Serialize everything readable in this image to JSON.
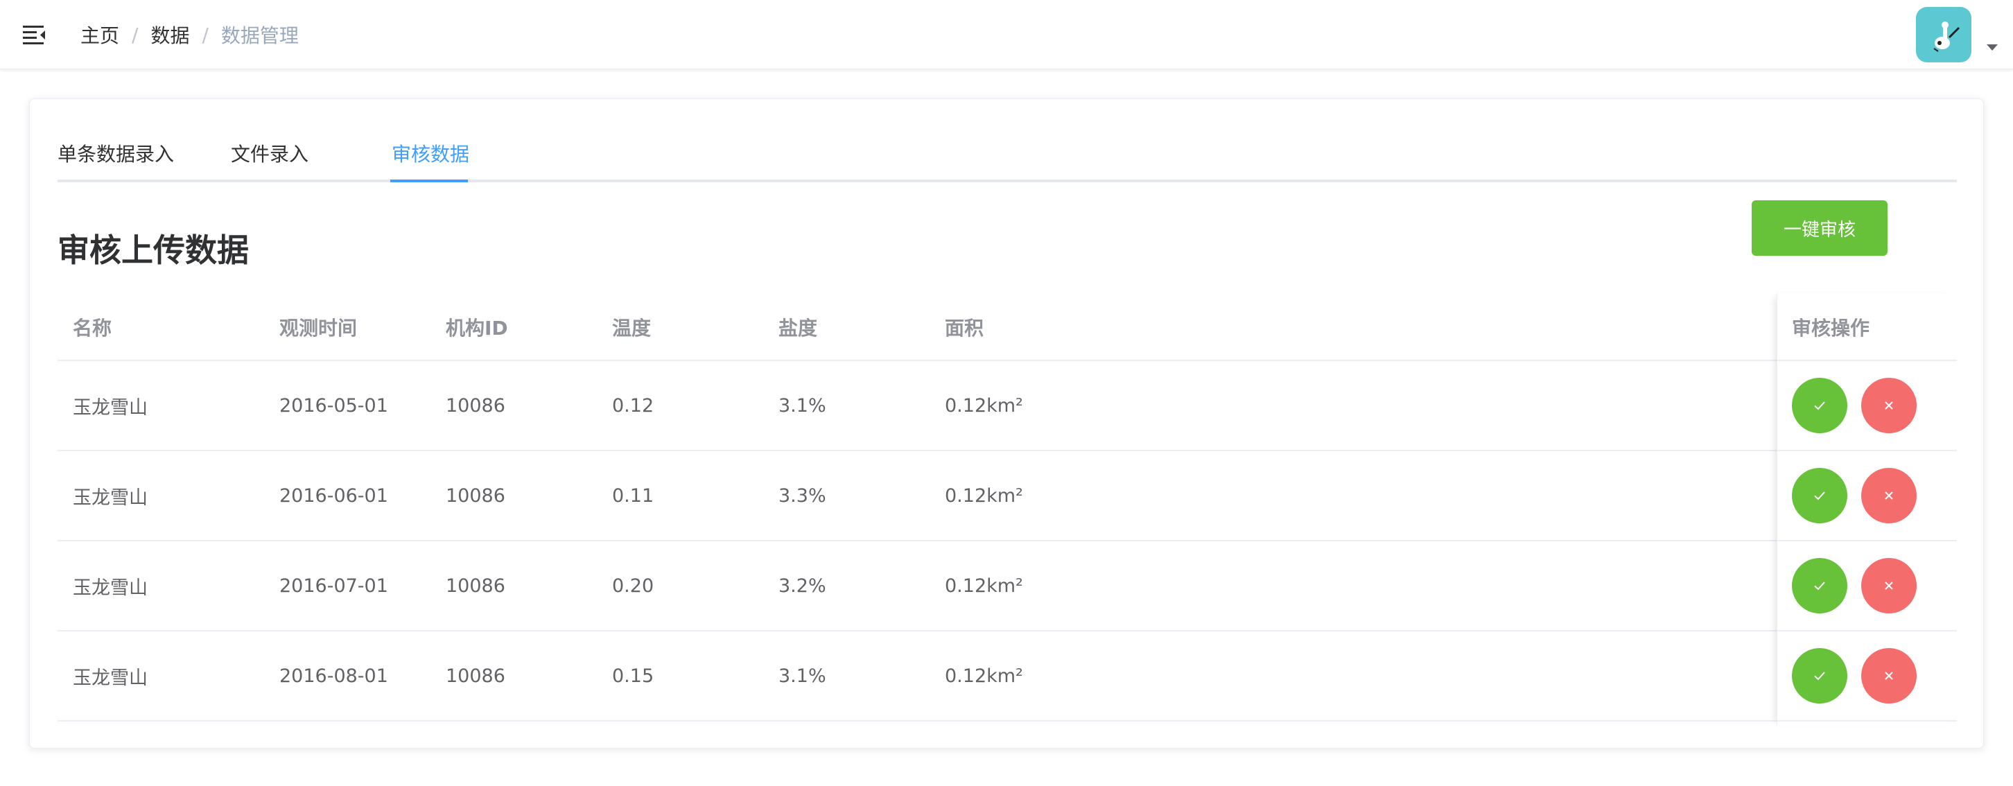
{
  "breadcrumb": [
    "主页",
    "数据",
    "数据管理"
  ],
  "breadcrumb_separator": "/",
  "tabs": [
    {
      "label": "单条数据录入",
      "active": false
    },
    {
      "label": "文件录入",
      "active": false
    },
    {
      "label": "审核数据",
      "active": true
    }
  ],
  "page_title": "审核上传数据",
  "audit_all_button": "一键审核",
  "table": {
    "columns": [
      "名称",
      "观测时间",
      "机构ID",
      "温度",
      "盐度",
      "面积",
      "审核操作"
    ],
    "rows": [
      {
        "name": "玉龙雪山",
        "time": "2016-05-01",
        "org_id": "10086",
        "temperature": "0.12",
        "salinity": "3.1%",
        "area": "0.12km²"
      },
      {
        "name": "玉龙雪山",
        "time": "2016-06-01",
        "org_id": "10086",
        "temperature": "0.11",
        "salinity": "3.3%",
        "area": "0.12km²"
      },
      {
        "name": "玉龙雪山",
        "time": "2016-07-01",
        "org_id": "10086",
        "temperature": "0.20",
        "salinity": "3.2%",
        "area": "0.12km²"
      },
      {
        "name": "玉龙雪山",
        "time": "2016-08-01",
        "org_id": "10086",
        "temperature": "0.15",
        "salinity": "3.1%",
        "area": "0.12km²"
      }
    ]
  },
  "icons": {
    "menu": "menu-fold-icon",
    "approve": "check-icon",
    "reject": "close-icon",
    "dropdown": "caret-down-icon"
  },
  "colors": {
    "accent": "#409eff",
    "success": "#67c23a",
    "danger": "#f56c6c",
    "avatar_bg": "#5cc8d1"
  }
}
